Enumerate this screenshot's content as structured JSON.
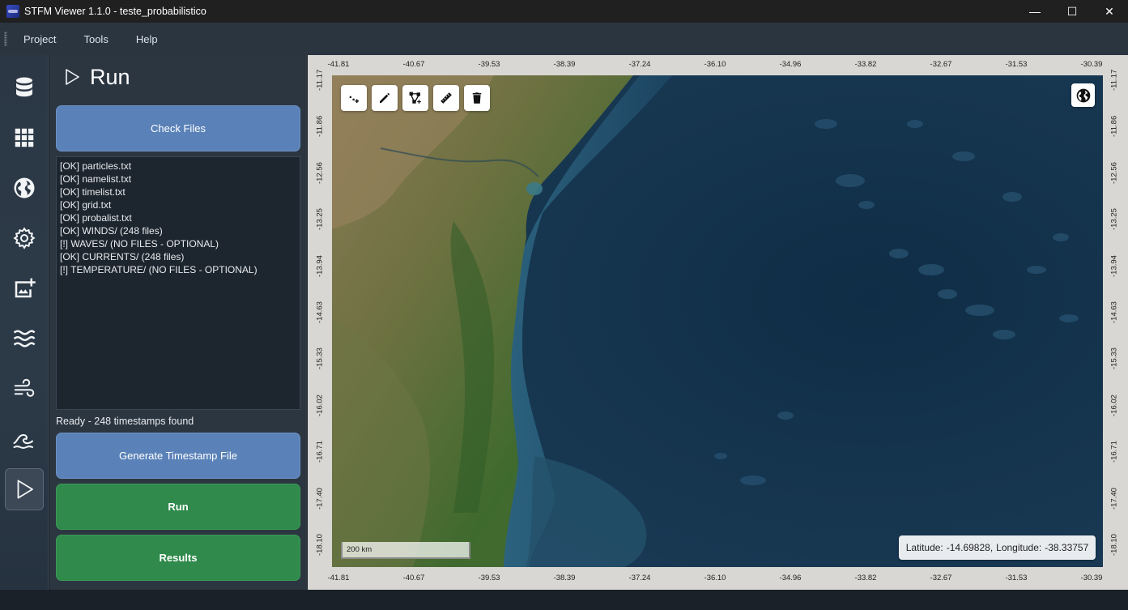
{
  "window": {
    "title": "STFM Viewer 1.1.0 - teste_probabilistico",
    "minimize_glyph": "—",
    "maximize_glyph": "☐",
    "close_glyph": "✕"
  },
  "menu": {
    "items": [
      "Project",
      "Tools",
      "Help"
    ]
  },
  "rail": {
    "icons": [
      "database-icon",
      "grid-icon",
      "globe-icon",
      "gear-icon",
      "image-add-icon",
      "waves-icon",
      "wind-icon",
      "ocean-wave-icon",
      "play-icon"
    ],
    "active": "play-icon"
  },
  "panel": {
    "title": "Run",
    "check_files_label": "Check Files",
    "log_lines": [
      "[OK] particles.txt",
      "[OK] namelist.txt",
      "[OK] timelist.txt",
      "[OK] grid.txt",
      "[OK] probalist.txt",
      "[OK] WINDS/ (248 files)",
      "[!] WAVES/ (NO FILES - OPTIONAL)",
      "[OK] CURRENTS/ (248 files)",
      "[!] TEMPERATURE/ (NO FILES - OPTIONAL)"
    ],
    "status": "Ready - 248 timestamps found",
    "generate_label": "Generate Timestamp File",
    "run_label": "Run",
    "results_label": "Results"
  },
  "map": {
    "lon_ticks": [
      "-41.81",
      "-40.67",
      "-39.53",
      "-38.39",
      "-37.24",
      "-36.10",
      "-34.96",
      "-33.82",
      "-32.67",
      "-31.53",
      "-30.39"
    ],
    "lat_ticks": [
      "-11.17",
      "-11.86",
      "-12.56",
      "-13.25",
      "-13.94",
      "-14.63",
      "-15.33",
      "-16.02",
      "-16.71",
      "-17.40",
      "-18.10"
    ],
    "toolbar": [
      "add-point-icon",
      "pencil-icon",
      "polygon-icon",
      "ruler-icon",
      "trash-icon"
    ],
    "layer_icon": "globe-icon",
    "scale_label": "200 km",
    "coord_lat_label": "Latitude:",
    "coord_lat_value": "-14.69828,",
    "coord_lon_label": "Longitude:",
    "coord_lon_value": "-38.33757"
  },
  "colors": {
    "titlebar": "#202020",
    "menubar": "#2a3540",
    "panel": "#2c3641",
    "button_blue": "#5a82b8",
    "button_green": "#2f8a4b",
    "ocean": "#17354e",
    "land": "#5f6b3a"
  }
}
